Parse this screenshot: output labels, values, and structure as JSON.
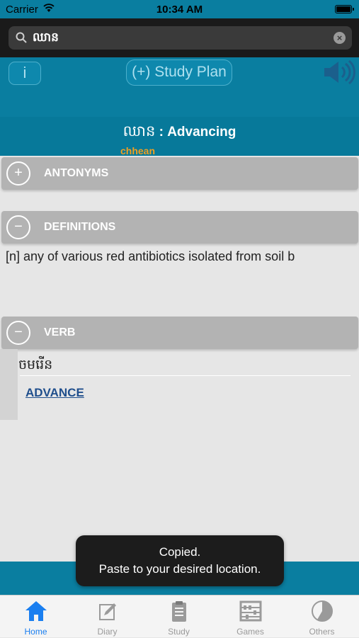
{
  "status_bar": {
    "carrier": "Carrier",
    "time": "10:34 AM"
  },
  "search": {
    "value": "ឈាន"
  },
  "toolbar": {
    "info_label": "i",
    "study_plan_label": "(+) Study Plan"
  },
  "word": {
    "khmer": "ឈាន",
    "separator": " : ",
    "english": "Advancing",
    "romanization": "chhean"
  },
  "sections": {
    "antonyms": {
      "toggle": "+",
      "label": "ANTONYMS"
    },
    "definitions": {
      "toggle": "−",
      "label": "DEFINITIONS",
      "text": "[n] any of various red antibiotics isolated from soil b"
    },
    "verb": {
      "toggle": "−",
      "label": "VERB",
      "khmer": "ចមរើន",
      "link": "ADVANCE"
    }
  },
  "toast": {
    "line1": "Copied.",
    "line2": "Paste to your desired location."
  },
  "tabs": [
    {
      "label": "Home",
      "icon": "house-icon",
      "active": true
    },
    {
      "label": "Diary",
      "icon": "pencil-note-icon",
      "active": false
    },
    {
      "label": "Study",
      "icon": "clipboard-icon",
      "active": false
    },
    {
      "label": "Games",
      "icon": "abacus-icon",
      "active": false
    },
    {
      "label": "Others",
      "icon": "pie-icon",
      "active": false
    }
  ],
  "colors": {
    "accent": "#0a7ea0",
    "active_tab": "#1a7ff0",
    "romanization": "#f0a020",
    "link": "#1f4e8c"
  }
}
